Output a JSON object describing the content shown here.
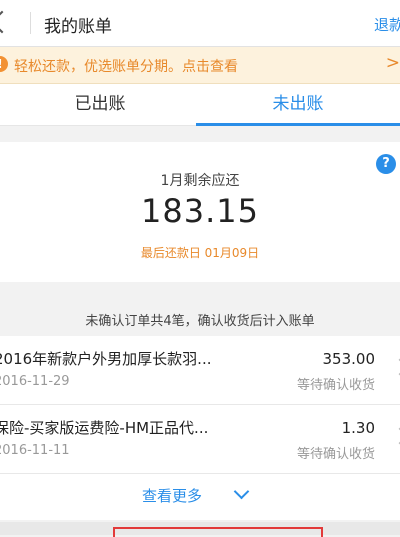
{
  "header": {
    "title": "我的账单",
    "right_action": "退款"
  },
  "notice": {
    "icon": "exclamation-icon",
    "text": "轻松还款，优选账单分期。点击查看",
    "arrow": ">"
  },
  "tabs": [
    {
      "label": "已出账",
      "active": false
    },
    {
      "label": "未出账",
      "active": true
    }
  ],
  "summary": {
    "help_icon": "?",
    "label": "1月剩余应还",
    "amount": "183.15",
    "due_text": "最后还款日 01月09日"
  },
  "unconfirmed": {
    "note": "未确认订单共4笔，确认收货后计入账单"
  },
  "orders": [
    {
      "title": "2016年新款户外男加厚长款羽...",
      "date": "2016-11-29",
      "amount": "353.00",
      "status": "等待确认收货"
    },
    {
      "title": "保险-买家版运费险-HM正品代...",
      "date": "2016-11-11",
      "amount": "1.30",
      "status": "等待确认收货"
    }
  ],
  "more": {
    "label": "查看更多"
  },
  "colors": {
    "accent": "#2a8ee8",
    "warning": "#e8892b",
    "notice_bg": "#fdf2dd"
  }
}
